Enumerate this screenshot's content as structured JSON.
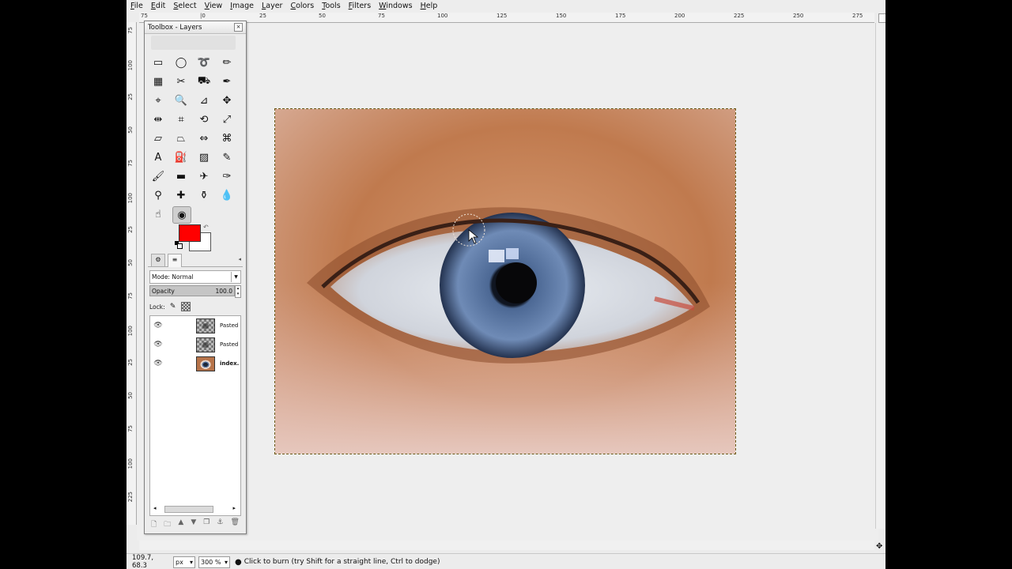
{
  "menu": [
    "File",
    "Edit",
    "Select",
    "View",
    "Image",
    "Layer",
    "Colors",
    "Tools",
    "Filters",
    "Windows",
    "Help"
  ],
  "rulers": {
    "h_labels": [
      "75",
      "|0",
      "25",
      "50",
      "75",
      "100",
      "125",
      "150",
      "175",
      "200",
      "225",
      "250",
      "275"
    ],
    "v_labels": [
      "75",
      "100",
      "25",
      "50",
      "75",
      "100",
      "25",
      "50",
      "75",
      "100",
      "25",
      "50",
      "75",
      "100",
      "225"
    ]
  },
  "toolbox": {
    "title": "Toolbox - Layers",
    "close_symbol": "×",
    "tools": [
      {
        "name": "rect-select-icon",
        "glyph": "▭"
      },
      {
        "name": "ellipse-select-icon",
        "glyph": "◯"
      },
      {
        "name": "free-select-icon",
        "glyph": "➰"
      },
      {
        "name": "fuzzy-select-icon",
        "glyph": "✏"
      },
      {
        "name": "select-by-color-icon",
        "glyph": "▦"
      },
      {
        "name": "scissors-icon",
        "glyph": "✂"
      },
      {
        "name": "foreground-select-icon",
        "glyph": "⛟"
      },
      {
        "name": "paths-icon",
        "glyph": "✒"
      },
      {
        "name": "color-picker-icon",
        "glyph": "⌖"
      },
      {
        "name": "zoom-icon",
        "glyph": "🔍"
      },
      {
        "name": "measure-icon",
        "glyph": "⊿"
      },
      {
        "name": "move-icon",
        "glyph": "✥"
      },
      {
        "name": "align-icon",
        "glyph": "⇹"
      },
      {
        "name": "crop-icon",
        "glyph": "⌗"
      },
      {
        "name": "rotate-icon",
        "glyph": "⟲"
      },
      {
        "name": "scale-icon",
        "glyph": "⤢"
      },
      {
        "name": "shear-icon",
        "glyph": "▱"
      },
      {
        "name": "perspective-icon",
        "glyph": "⏢"
      },
      {
        "name": "flip-icon",
        "glyph": "⇔"
      },
      {
        "name": "cage-icon",
        "glyph": "⌘"
      },
      {
        "name": "text-icon",
        "glyph": "A"
      },
      {
        "name": "bucket-fill-icon",
        "glyph": "⛽"
      },
      {
        "name": "blend-icon",
        "glyph": "▨"
      },
      {
        "name": "pencil-icon",
        "glyph": "✎"
      },
      {
        "name": "paintbrush-icon",
        "glyph": "🖌"
      },
      {
        "name": "eraser-icon",
        "glyph": "▬"
      },
      {
        "name": "airbrush-icon",
        "glyph": "✈"
      },
      {
        "name": "ink-icon",
        "glyph": "✑"
      },
      {
        "name": "clone-icon",
        "glyph": "⚲"
      },
      {
        "name": "heal-icon",
        "glyph": "✚"
      },
      {
        "name": "perspective-clone-icon",
        "glyph": "⚱"
      },
      {
        "name": "blur-sharpen-icon",
        "glyph": "💧"
      },
      {
        "name": "smudge-icon",
        "glyph": "☝"
      },
      {
        "name": "dodge-burn-icon",
        "glyph": "◉"
      }
    ],
    "colors": {
      "foreground": "#ff0000",
      "background": "#ffffff",
      "swap_symbol": "↶"
    },
    "tabs": [
      {
        "name": "tab-tool-options",
        "glyph": "⚙"
      },
      {
        "name": "tab-layers",
        "glyph": "≡"
      }
    ],
    "tabs_menu_symbol": "◂",
    "mode_label": "Mode:",
    "mode_value": "Normal",
    "opacity_label": "Opacity",
    "opacity_value": "100.0",
    "lock_label": "Lock:",
    "layers": [
      {
        "name": "Pasted",
        "visible": "👁",
        "thumb": "checker",
        "bold": false
      },
      {
        "name": "Pasted",
        "visible": "👁",
        "thumb": "checker",
        "bold": false
      },
      {
        "name": "index.",
        "visible": "👁",
        "thumb": "eye",
        "bold": true
      }
    ],
    "layer_buttons": [
      "new-layer-icon",
      "new-group-icon",
      "raise-layer-icon",
      "lower-layer-icon",
      "duplicate-layer-icon",
      "anchor-layer-icon",
      "delete-layer-icon"
    ],
    "layer_button_glyphs": [
      "🗋",
      "🗀",
      "▲",
      "▼",
      "❐",
      "⚓",
      "🗑"
    ]
  },
  "status": {
    "coords": "109.7, 68.3",
    "unit": "px",
    "zoom": "300 %",
    "message": "Click to burn (try Shift for a straight line, Ctrl to dodge)"
  }
}
